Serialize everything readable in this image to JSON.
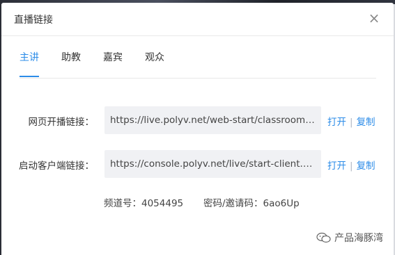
{
  "modal": {
    "title": "直播链接",
    "close_icon": "×"
  },
  "tabs": [
    {
      "label": "主讲",
      "active": true
    },
    {
      "label": "助教",
      "active": false
    },
    {
      "label": "嘉宾",
      "active": false
    },
    {
      "label": "观众",
      "active": false
    }
  ],
  "links": [
    {
      "label": "网页开播链接：",
      "url": "https://live.polyv.net/web-start/classroom?cha...",
      "open_label": "打开",
      "copy_label": "复制"
    },
    {
      "label": "启动客户端链接：",
      "url": "https://console.polyv.net/live/start-client.html?...",
      "open_label": "打开",
      "copy_label": "复制"
    }
  ],
  "channel": {
    "label": "频道号：4054495",
    "password": "密码/邀请码：6ao6Up"
  },
  "watermark": {
    "text": "产品海豚湾",
    "icon": "wechat-logo"
  },
  "colors": {
    "accent": "#2c8ce8",
    "field_bg": "#f0f1f4"
  }
}
